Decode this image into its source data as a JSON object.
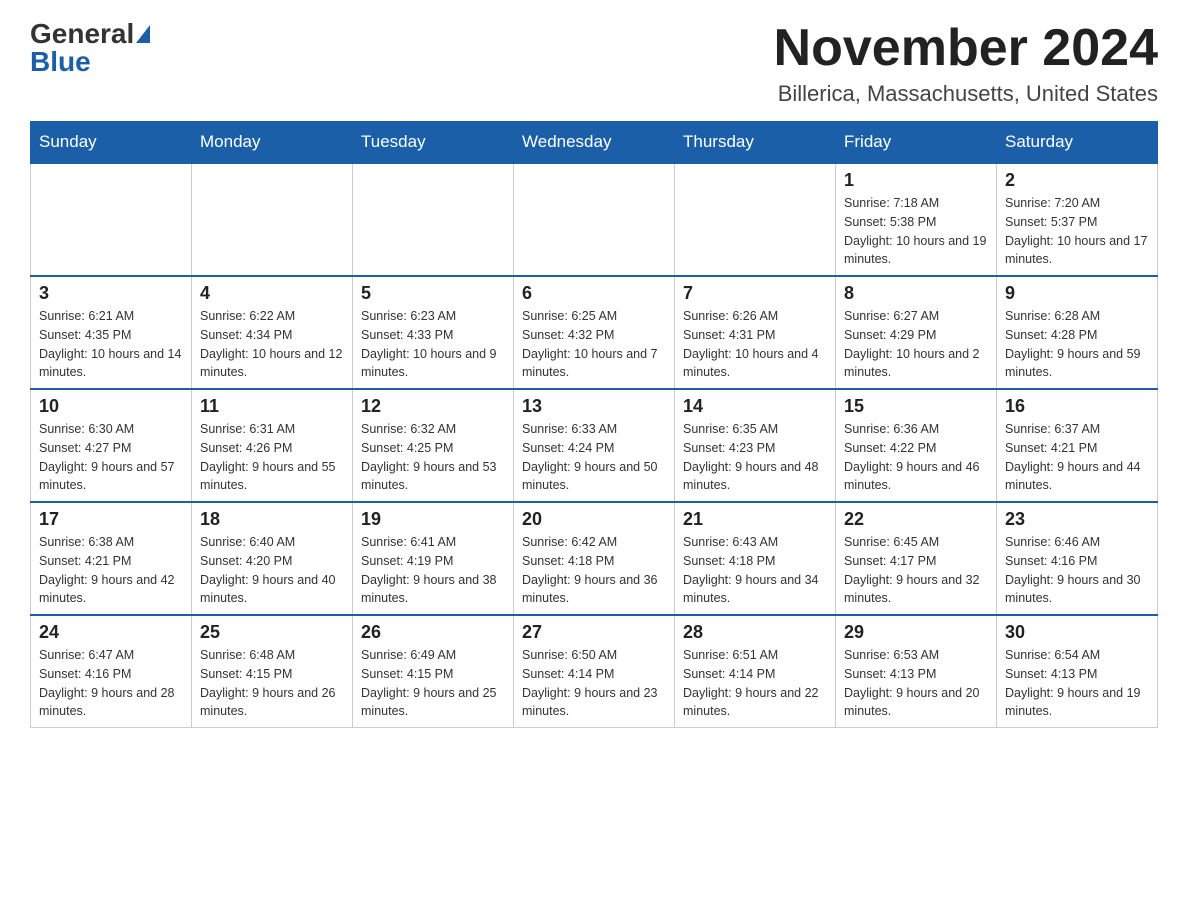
{
  "header": {
    "logo_general": "General",
    "logo_blue": "Blue",
    "month_title": "November 2024",
    "location": "Billerica, Massachusetts, United States"
  },
  "weekdays": [
    "Sunday",
    "Monday",
    "Tuesday",
    "Wednesday",
    "Thursday",
    "Friday",
    "Saturday"
  ],
  "weeks": [
    [
      {
        "day": "",
        "empty": true
      },
      {
        "day": "",
        "empty": true
      },
      {
        "day": "",
        "empty": true
      },
      {
        "day": "",
        "empty": true
      },
      {
        "day": "",
        "empty": true
      },
      {
        "day": "1",
        "sunrise": "Sunrise: 7:18 AM",
        "sunset": "Sunset: 5:38 PM",
        "daylight": "Daylight: 10 hours and 19 minutes."
      },
      {
        "day": "2",
        "sunrise": "Sunrise: 7:20 AM",
        "sunset": "Sunset: 5:37 PM",
        "daylight": "Daylight: 10 hours and 17 minutes."
      }
    ],
    [
      {
        "day": "3",
        "sunrise": "Sunrise: 6:21 AM",
        "sunset": "Sunset: 4:35 PM",
        "daylight": "Daylight: 10 hours and 14 minutes."
      },
      {
        "day": "4",
        "sunrise": "Sunrise: 6:22 AM",
        "sunset": "Sunset: 4:34 PM",
        "daylight": "Daylight: 10 hours and 12 minutes."
      },
      {
        "day": "5",
        "sunrise": "Sunrise: 6:23 AM",
        "sunset": "Sunset: 4:33 PM",
        "daylight": "Daylight: 10 hours and 9 minutes."
      },
      {
        "day": "6",
        "sunrise": "Sunrise: 6:25 AM",
        "sunset": "Sunset: 4:32 PM",
        "daylight": "Daylight: 10 hours and 7 minutes."
      },
      {
        "day": "7",
        "sunrise": "Sunrise: 6:26 AM",
        "sunset": "Sunset: 4:31 PM",
        "daylight": "Daylight: 10 hours and 4 minutes."
      },
      {
        "day": "8",
        "sunrise": "Sunrise: 6:27 AM",
        "sunset": "Sunset: 4:29 PM",
        "daylight": "Daylight: 10 hours and 2 minutes."
      },
      {
        "day": "9",
        "sunrise": "Sunrise: 6:28 AM",
        "sunset": "Sunset: 4:28 PM",
        "daylight": "Daylight: 9 hours and 59 minutes."
      }
    ],
    [
      {
        "day": "10",
        "sunrise": "Sunrise: 6:30 AM",
        "sunset": "Sunset: 4:27 PM",
        "daylight": "Daylight: 9 hours and 57 minutes."
      },
      {
        "day": "11",
        "sunrise": "Sunrise: 6:31 AM",
        "sunset": "Sunset: 4:26 PM",
        "daylight": "Daylight: 9 hours and 55 minutes."
      },
      {
        "day": "12",
        "sunrise": "Sunrise: 6:32 AM",
        "sunset": "Sunset: 4:25 PM",
        "daylight": "Daylight: 9 hours and 53 minutes."
      },
      {
        "day": "13",
        "sunrise": "Sunrise: 6:33 AM",
        "sunset": "Sunset: 4:24 PM",
        "daylight": "Daylight: 9 hours and 50 minutes."
      },
      {
        "day": "14",
        "sunrise": "Sunrise: 6:35 AM",
        "sunset": "Sunset: 4:23 PM",
        "daylight": "Daylight: 9 hours and 48 minutes."
      },
      {
        "day": "15",
        "sunrise": "Sunrise: 6:36 AM",
        "sunset": "Sunset: 4:22 PM",
        "daylight": "Daylight: 9 hours and 46 minutes."
      },
      {
        "day": "16",
        "sunrise": "Sunrise: 6:37 AM",
        "sunset": "Sunset: 4:21 PM",
        "daylight": "Daylight: 9 hours and 44 minutes."
      }
    ],
    [
      {
        "day": "17",
        "sunrise": "Sunrise: 6:38 AM",
        "sunset": "Sunset: 4:21 PM",
        "daylight": "Daylight: 9 hours and 42 minutes."
      },
      {
        "day": "18",
        "sunrise": "Sunrise: 6:40 AM",
        "sunset": "Sunset: 4:20 PM",
        "daylight": "Daylight: 9 hours and 40 minutes."
      },
      {
        "day": "19",
        "sunrise": "Sunrise: 6:41 AM",
        "sunset": "Sunset: 4:19 PM",
        "daylight": "Daylight: 9 hours and 38 minutes."
      },
      {
        "day": "20",
        "sunrise": "Sunrise: 6:42 AM",
        "sunset": "Sunset: 4:18 PM",
        "daylight": "Daylight: 9 hours and 36 minutes."
      },
      {
        "day": "21",
        "sunrise": "Sunrise: 6:43 AM",
        "sunset": "Sunset: 4:18 PM",
        "daylight": "Daylight: 9 hours and 34 minutes."
      },
      {
        "day": "22",
        "sunrise": "Sunrise: 6:45 AM",
        "sunset": "Sunset: 4:17 PM",
        "daylight": "Daylight: 9 hours and 32 minutes."
      },
      {
        "day": "23",
        "sunrise": "Sunrise: 6:46 AM",
        "sunset": "Sunset: 4:16 PM",
        "daylight": "Daylight: 9 hours and 30 minutes."
      }
    ],
    [
      {
        "day": "24",
        "sunrise": "Sunrise: 6:47 AM",
        "sunset": "Sunset: 4:16 PM",
        "daylight": "Daylight: 9 hours and 28 minutes."
      },
      {
        "day": "25",
        "sunrise": "Sunrise: 6:48 AM",
        "sunset": "Sunset: 4:15 PM",
        "daylight": "Daylight: 9 hours and 26 minutes."
      },
      {
        "day": "26",
        "sunrise": "Sunrise: 6:49 AM",
        "sunset": "Sunset: 4:15 PM",
        "daylight": "Daylight: 9 hours and 25 minutes."
      },
      {
        "day": "27",
        "sunrise": "Sunrise: 6:50 AM",
        "sunset": "Sunset: 4:14 PM",
        "daylight": "Daylight: 9 hours and 23 minutes."
      },
      {
        "day": "28",
        "sunrise": "Sunrise: 6:51 AM",
        "sunset": "Sunset: 4:14 PM",
        "daylight": "Daylight: 9 hours and 22 minutes."
      },
      {
        "day": "29",
        "sunrise": "Sunrise: 6:53 AM",
        "sunset": "Sunset: 4:13 PM",
        "daylight": "Daylight: 9 hours and 20 minutes."
      },
      {
        "day": "30",
        "sunrise": "Sunrise: 6:54 AM",
        "sunset": "Sunset: 4:13 PM",
        "daylight": "Daylight: 9 hours and 19 minutes."
      }
    ]
  ]
}
